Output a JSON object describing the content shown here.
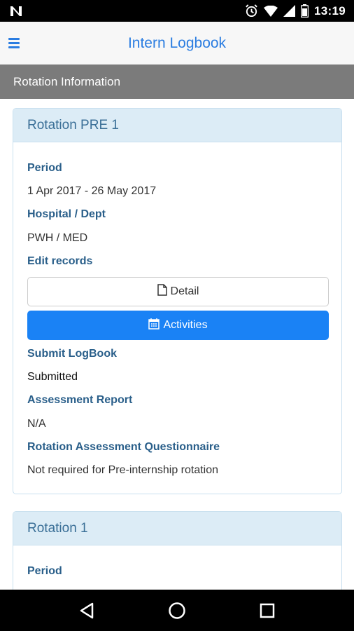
{
  "status_bar": {
    "time": "13:19",
    "icons": [
      "n-logo-icon",
      "alarm-icon",
      "wifi-icon",
      "signal-icon",
      "battery-icon"
    ]
  },
  "app_bar": {
    "title": "Intern Logbook",
    "menu_icon": "hamburger-menu-icon"
  },
  "section": {
    "title": "Rotation Information"
  },
  "rotations": [
    {
      "title": "Rotation PRE 1",
      "period_label": "Period",
      "period_value": "1 Apr 2017 - 26 May 2017",
      "hospital_label": "Hospital / Dept",
      "hospital_value": "PWH / MED",
      "edit_label": "Edit records",
      "detail_button": "Detail",
      "activities_button": "Activities",
      "submit_label": "Submit LogBook",
      "submit_value": "Submitted",
      "assessment_label": "Assessment Report",
      "assessment_value": "N/A",
      "questionnaire_label": "Rotation Assessment Questionnaire",
      "questionnaire_value": "Not required for Pre-internship rotation"
    },
    {
      "title": "Rotation 1",
      "period_label": "Period"
    }
  ],
  "colors": {
    "accent": "#2b7de1",
    "primary_button": "#1a82f5",
    "section_bar": "#7b7b7b",
    "card_header": "#dcecf6",
    "label": "#2a5f8a"
  }
}
